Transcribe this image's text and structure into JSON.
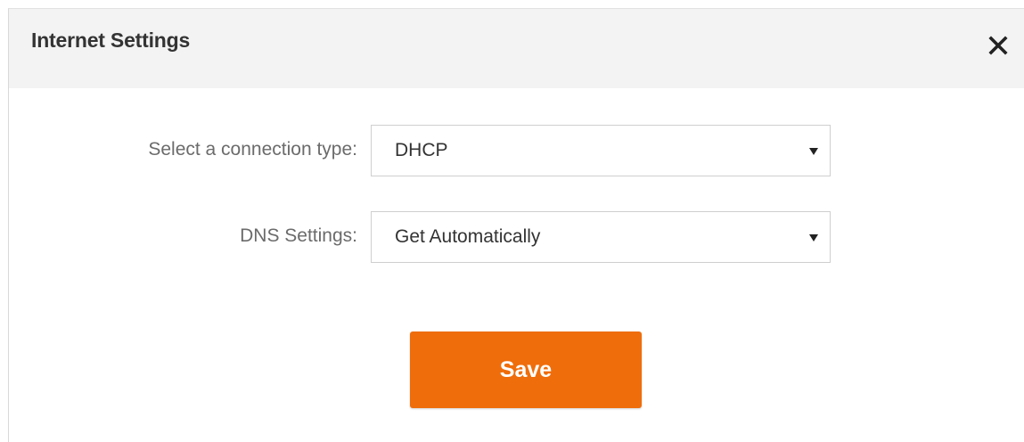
{
  "dialog": {
    "title": "Internet Settings",
    "close_icon": "close-icon"
  },
  "form": {
    "connection_type": {
      "label": "Select a connection type:",
      "value": "DHCP",
      "arrow_icon": "caret-down-icon"
    },
    "dns_settings": {
      "label": "DNS Settings:",
      "value": "Get Automatically",
      "arrow_icon": "caret-down-icon"
    },
    "save_label": "Save"
  },
  "colors": {
    "accent": "#ef6d0b",
    "header_bg": "#f3f3f3",
    "text_dark": "#333333",
    "text_label": "#6b6b6b",
    "border": "#cfcfcf"
  }
}
